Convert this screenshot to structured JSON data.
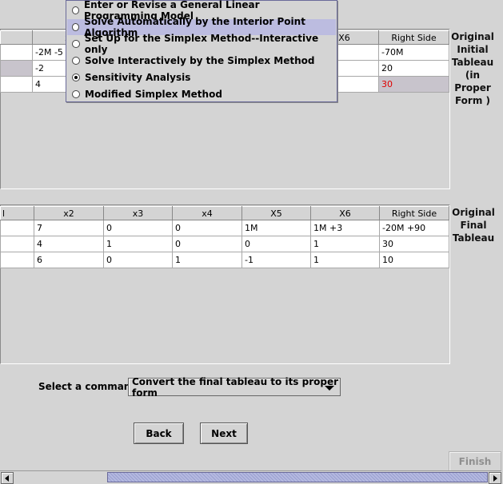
{
  "menu": {
    "items": [
      {
        "label": "Enter or Revise a General Linear Programming Model",
        "selected": false,
        "highlighted": false
      },
      {
        "label": "Solve Automatically by the Interior Point Algorithm",
        "selected": false,
        "highlighted": true
      },
      {
        "label": "Set Up for the Simplex Method--Interactive only",
        "selected": false,
        "highlighted": false
      },
      {
        "label": "Solve Interactively by the Simplex Method",
        "selected": false,
        "highlighted": false
      },
      {
        "label": "Sensitivity Analysis",
        "selected": true,
        "highlighted": false
      },
      {
        "label": "Modified Simplex Method",
        "selected": false,
        "highlighted": false
      }
    ]
  },
  "initial": {
    "side_label_lines": [
      "Original",
      "Initial",
      "Tableau",
      "(in Proper",
      "Form )"
    ],
    "headers": [
      "",
      "x",
      "",
      "",
      "",
      "X6",
      "Right Side"
    ],
    "rows": [
      [
        "",
        "-2M -5",
        "",
        "",
        "",
        "",
        "-70M"
      ],
      [
        "",
        "-2",
        "",
        "",
        "",
        "",
        "20"
      ],
      [
        "",
        "4",
        "",
        "",
        "",
        "",
        "30"
      ]
    ],
    "highlight_color": "#e00000"
  },
  "final": {
    "side_label_lines": [
      "Original",
      "Final",
      "Tableau"
    ],
    "headers": [
      "l",
      "x2",
      "x3",
      "x4",
      "X5",
      "X6",
      "Right Side"
    ],
    "rows": [
      [
        "",
        "7",
        "0",
        "0",
        "1M",
        "1M +3",
        "-20M +90"
      ],
      [
        "",
        "4",
        "1",
        "0",
        "0",
        "1",
        "30"
      ],
      [
        "",
        "6",
        "0",
        "1",
        "-1",
        "1",
        "10"
      ]
    ]
  },
  "command": {
    "label": "Select a command",
    "selected": "Convert the final tableau to its proper form"
  },
  "buttons": {
    "back": "Back",
    "next": "Next",
    "finish": "Finish"
  }
}
